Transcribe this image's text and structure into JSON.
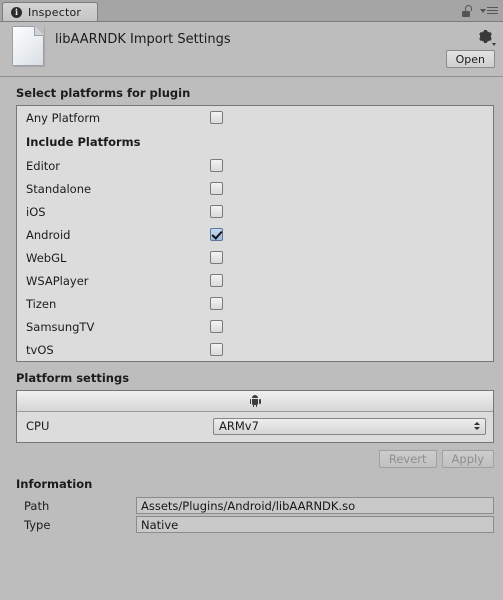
{
  "window": {
    "tab_label": "Inspector",
    "tab_icon": "info-circle-icon",
    "lock_icon": "lock-open-icon",
    "menu_icon": "hamburger-menu-icon"
  },
  "asset": {
    "title": "libAARNDK Import Settings",
    "thumbnail_icon": "document-file-icon",
    "gear_icon": "gear-icon",
    "open_label": "Open"
  },
  "platforms": {
    "section_title": "Select platforms for plugin",
    "any_platform": {
      "label": "Any Platform",
      "checked": false
    },
    "group_label": "Include Platforms",
    "items": [
      {
        "label": "Editor",
        "checked": false
      },
      {
        "label": "Standalone",
        "checked": false
      },
      {
        "label": "iOS",
        "checked": false
      },
      {
        "label": "Android",
        "checked": true
      },
      {
        "label": "WebGL",
        "checked": false
      },
      {
        "label": "WSAPlayer",
        "checked": false
      },
      {
        "label": "Tizen",
        "checked": false
      },
      {
        "label": "SamsungTV",
        "checked": false
      },
      {
        "label": "tvOS",
        "checked": false
      }
    ]
  },
  "platform_settings": {
    "section_title": "Platform settings",
    "active_tab_icon": "android-robot-icon",
    "cpu_label": "CPU",
    "cpu_value": "ARMv7",
    "revert_label": "Revert",
    "apply_label": "Apply"
  },
  "information": {
    "section_title": "Information",
    "rows": [
      {
        "label": "Path",
        "value": "Assets/Plugins/Android/libAARNDK.so"
      },
      {
        "label": "Type",
        "value": "Native"
      }
    ]
  },
  "colors": {
    "window_bg": "#bdbdbd",
    "panel_bg": "#dcdcdc",
    "checkbox_checked": "#9dbcdd",
    "border": "#767676"
  }
}
